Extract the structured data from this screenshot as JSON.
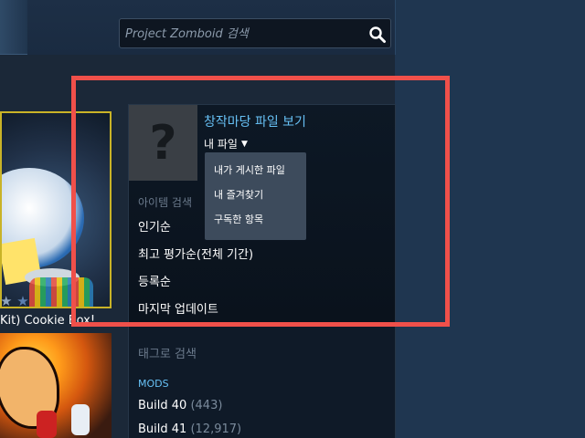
{
  "search": {
    "placeholder": "Project Zomboid 검색",
    "icon": "search-icon"
  },
  "items": [
    {
      "title": "Kit) Cookie Box!",
      "rating_stars_shown": 2
    }
  ],
  "sidebar": {
    "workshop_files_link": "창작마당 파일 보기",
    "my_files_label": "내 파일",
    "my_files_menu": [
      {
        "label": "내가 게시한 파일"
      },
      {
        "label": "내 즐겨찾기"
      },
      {
        "label": "구독한 항목"
      }
    ],
    "item_search_label": "아이템 검색",
    "sort_options": [
      {
        "label": "인기순"
      },
      {
        "label": "최고 평가순(전체 기간)"
      },
      {
        "label": "등록순"
      },
      {
        "label": "마지막 업데이트"
      }
    ],
    "tag_search_label": "태그로 검색",
    "mods_label": "MODS",
    "builds": [
      {
        "label": "Build 40",
        "count": "(443)"
      },
      {
        "label": "Build 41",
        "count": "(12,917)"
      }
    ]
  },
  "colors": {
    "background": "#1b2838",
    "link": "#67c1f5",
    "highlight": "#f0504a",
    "selected_border": "#c9b327"
  }
}
